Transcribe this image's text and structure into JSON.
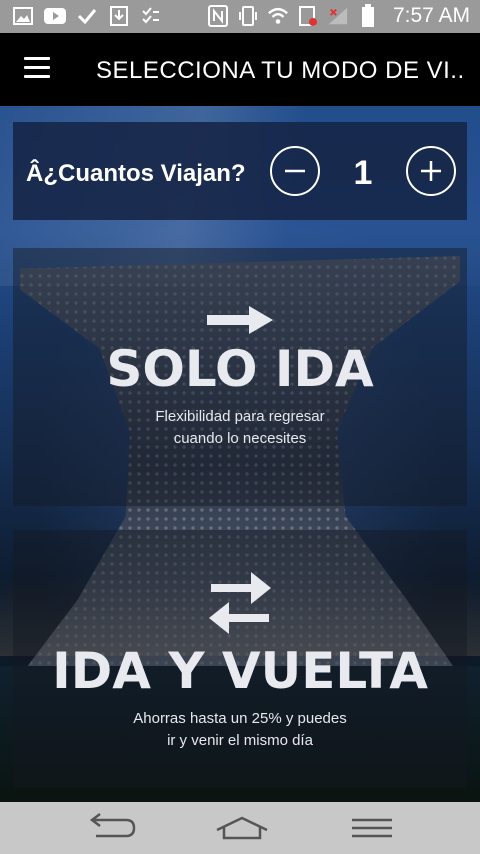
{
  "status_bar": {
    "time": "7:57 AM",
    "left_icons": [
      "image-icon",
      "youtube-icon",
      "check-icon",
      "download-icon",
      "tasks-icon"
    ],
    "right_icons": [
      "nfc-icon",
      "vibrate-icon",
      "wifi-icon",
      "sim-icon",
      "signal-icon",
      "battery-icon"
    ]
  },
  "app_bar": {
    "title": "SELECCIONA TU MODO DE VI..."
  },
  "passengers": {
    "label": "Â¿Cuantos Viajan?",
    "count": "1"
  },
  "options": {
    "one_way": {
      "title": "SOLO IDA",
      "subtitle_line1": "Flexibilidad para regresar",
      "subtitle_line2": "cuando lo necesites"
    },
    "round_trip": {
      "title": "IDA Y VUELTA",
      "subtitle_line1": "Ahorras hasta un 25% y puedes",
      "subtitle_line2": "ir y venir el mismo día"
    }
  },
  "nav_bar": {
    "buttons": [
      "back-icon",
      "home-icon",
      "menu-icon"
    ]
  }
}
